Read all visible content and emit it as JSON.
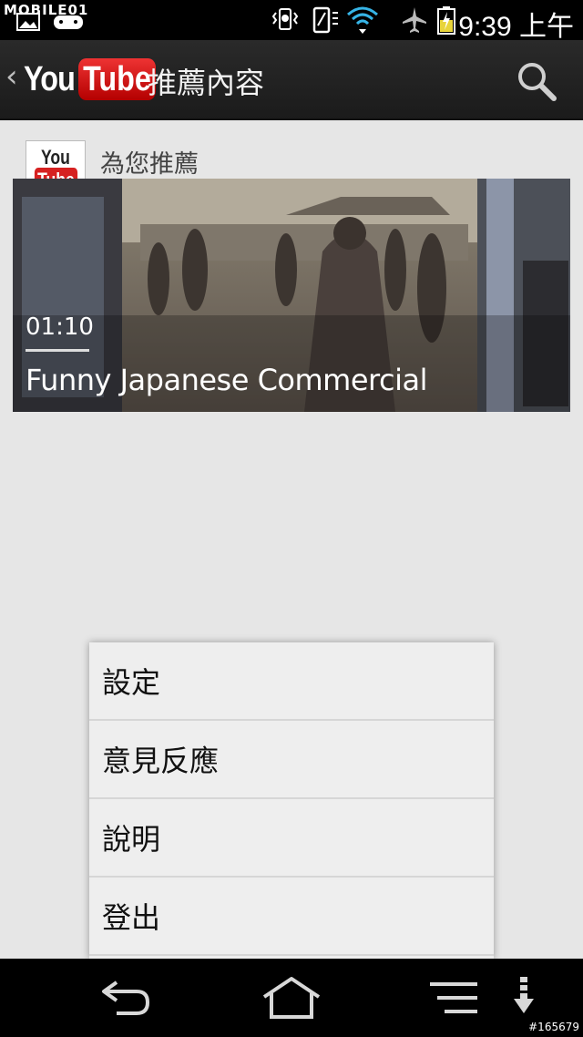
{
  "status_bar": {
    "watermark": "MOBILE01",
    "clock": "9:39 上午",
    "icons": [
      "gallery-notification-icon",
      "game-controller-icon",
      "vibrate-alarm-icon",
      "screen-rotation-icon",
      "wifi-icon",
      "airplane-mode-icon",
      "battery-charging-icon"
    ]
  },
  "action_bar": {
    "back_icon": "chevron-left-icon",
    "logo_you": "You",
    "logo_tube": "Tube",
    "title": "推薦內容",
    "search_icon": "search-icon"
  },
  "content": {
    "section_logo_you": "You",
    "section_logo_tube": "Tube",
    "section_label": "為您推薦",
    "video": {
      "duration": "01:10",
      "title": "Funny Japanese Commercial"
    }
  },
  "menu": {
    "items": [
      {
        "label": "設定"
      },
      {
        "label": "意見反應"
      },
      {
        "label": "說明"
      },
      {
        "label": "登出"
      }
    ]
  },
  "nav_bar": {
    "buttons": [
      "back-icon",
      "home-icon",
      "menu-icon",
      "download-icon"
    ]
  },
  "corner_id": "#165679",
  "colors": {
    "youtube_red": "#d62121",
    "action_bar": "#222222",
    "background": "#e6e6e6"
  }
}
